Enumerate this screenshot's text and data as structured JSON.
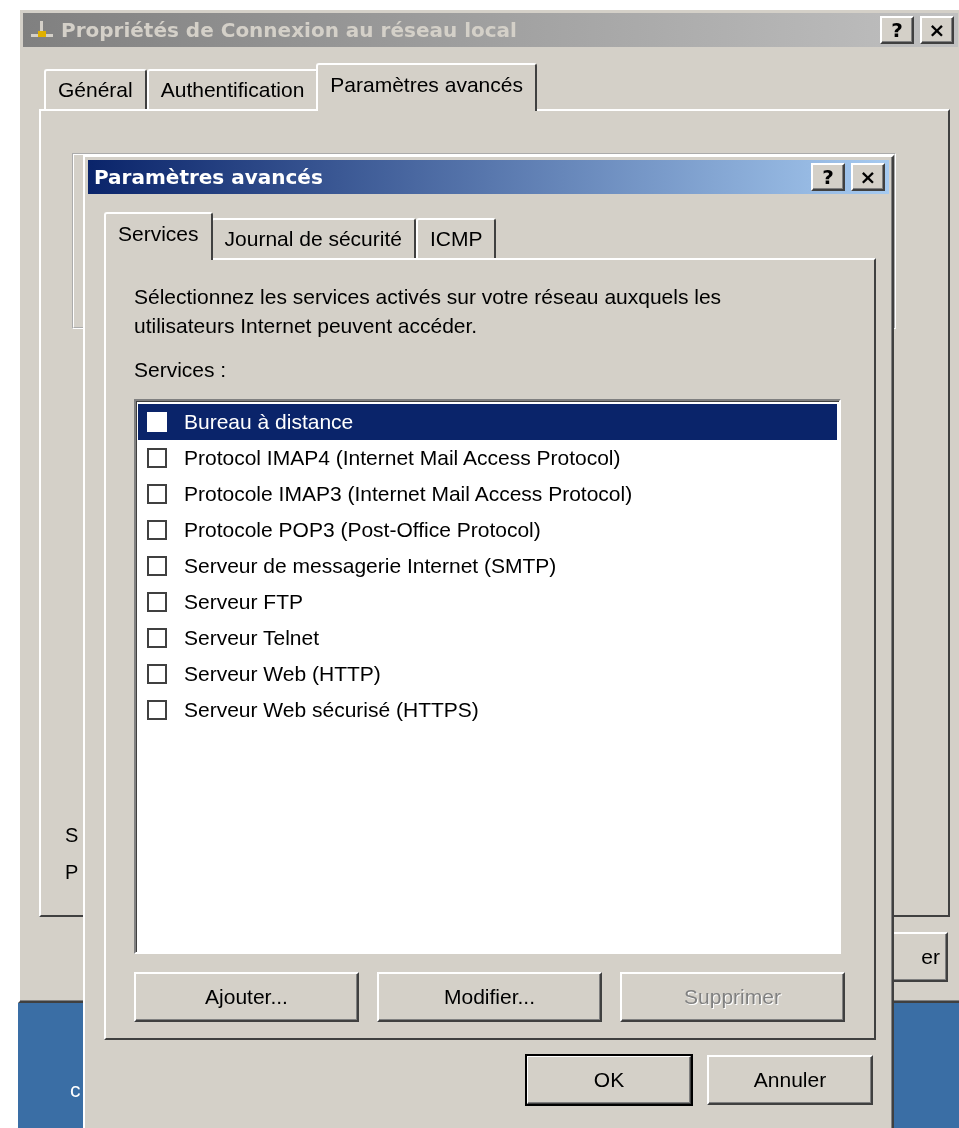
{
  "back_window": {
    "title": "Propriétés de Connexion au réseau local",
    "help_button": "?",
    "close_button": "×",
    "tabs": [
      {
        "label": "Général",
        "selected": false
      },
      {
        "label": "Authentification",
        "selected": false
      },
      {
        "label": "Paramètres avancés",
        "selected": true
      }
    ],
    "panel_labels": [
      "S",
      "P"
    ],
    "button": "er"
  },
  "desktop_text": "c",
  "dialog": {
    "title": "Paramètres avancés",
    "help_button": "?",
    "close_button": "×",
    "tabs": [
      {
        "label": "Services",
        "selected": true
      },
      {
        "label": "Journal de sécurité",
        "selected": false
      },
      {
        "label": "ICMP",
        "selected": false
      }
    ],
    "description": "Sélectionnez les services activés sur votre réseau auxquels les utilisateurs Internet peuvent accéder.",
    "list_label": "Services :",
    "services": [
      {
        "label": "Bureau à distance",
        "checked": false,
        "selected": true
      },
      {
        "label": "Protocol IMAP4 (Internet Mail Access Protocol)",
        "checked": false,
        "selected": false
      },
      {
        "label": "Protocole IMAP3 (Internet Mail Access Protocol)",
        "checked": false,
        "selected": false
      },
      {
        "label": "Protocole POP3 (Post-Office Protocol)",
        "checked": false,
        "selected": false
      },
      {
        "label": "Serveur de messagerie Internet (SMTP)",
        "checked": false,
        "selected": false
      },
      {
        "label": "Serveur FTP",
        "checked": false,
        "selected": false
      },
      {
        "label": "Serveur Telnet",
        "checked": false,
        "selected": false
      },
      {
        "label": "Serveur Web (HTTP)",
        "checked": false,
        "selected": false
      },
      {
        "label": "Serveur Web sécurisé (HTTPS)",
        "checked": false,
        "selected": false
      }
    ],
    "list_buttons": [
      {
        "label": "Ajouter...",
        "disabled": false
      },
      {
        "label": "Modifier...",
        "disabled": false
      },
      {
        "label": "Supprimer",
        "disabled": true
      }
    ],
    "footer_buttons": [
      {
        "label": "OK",
        "default": true
      },
      {
        "label": "Annuler",
        "default": false
      }
    ]
  }
}
